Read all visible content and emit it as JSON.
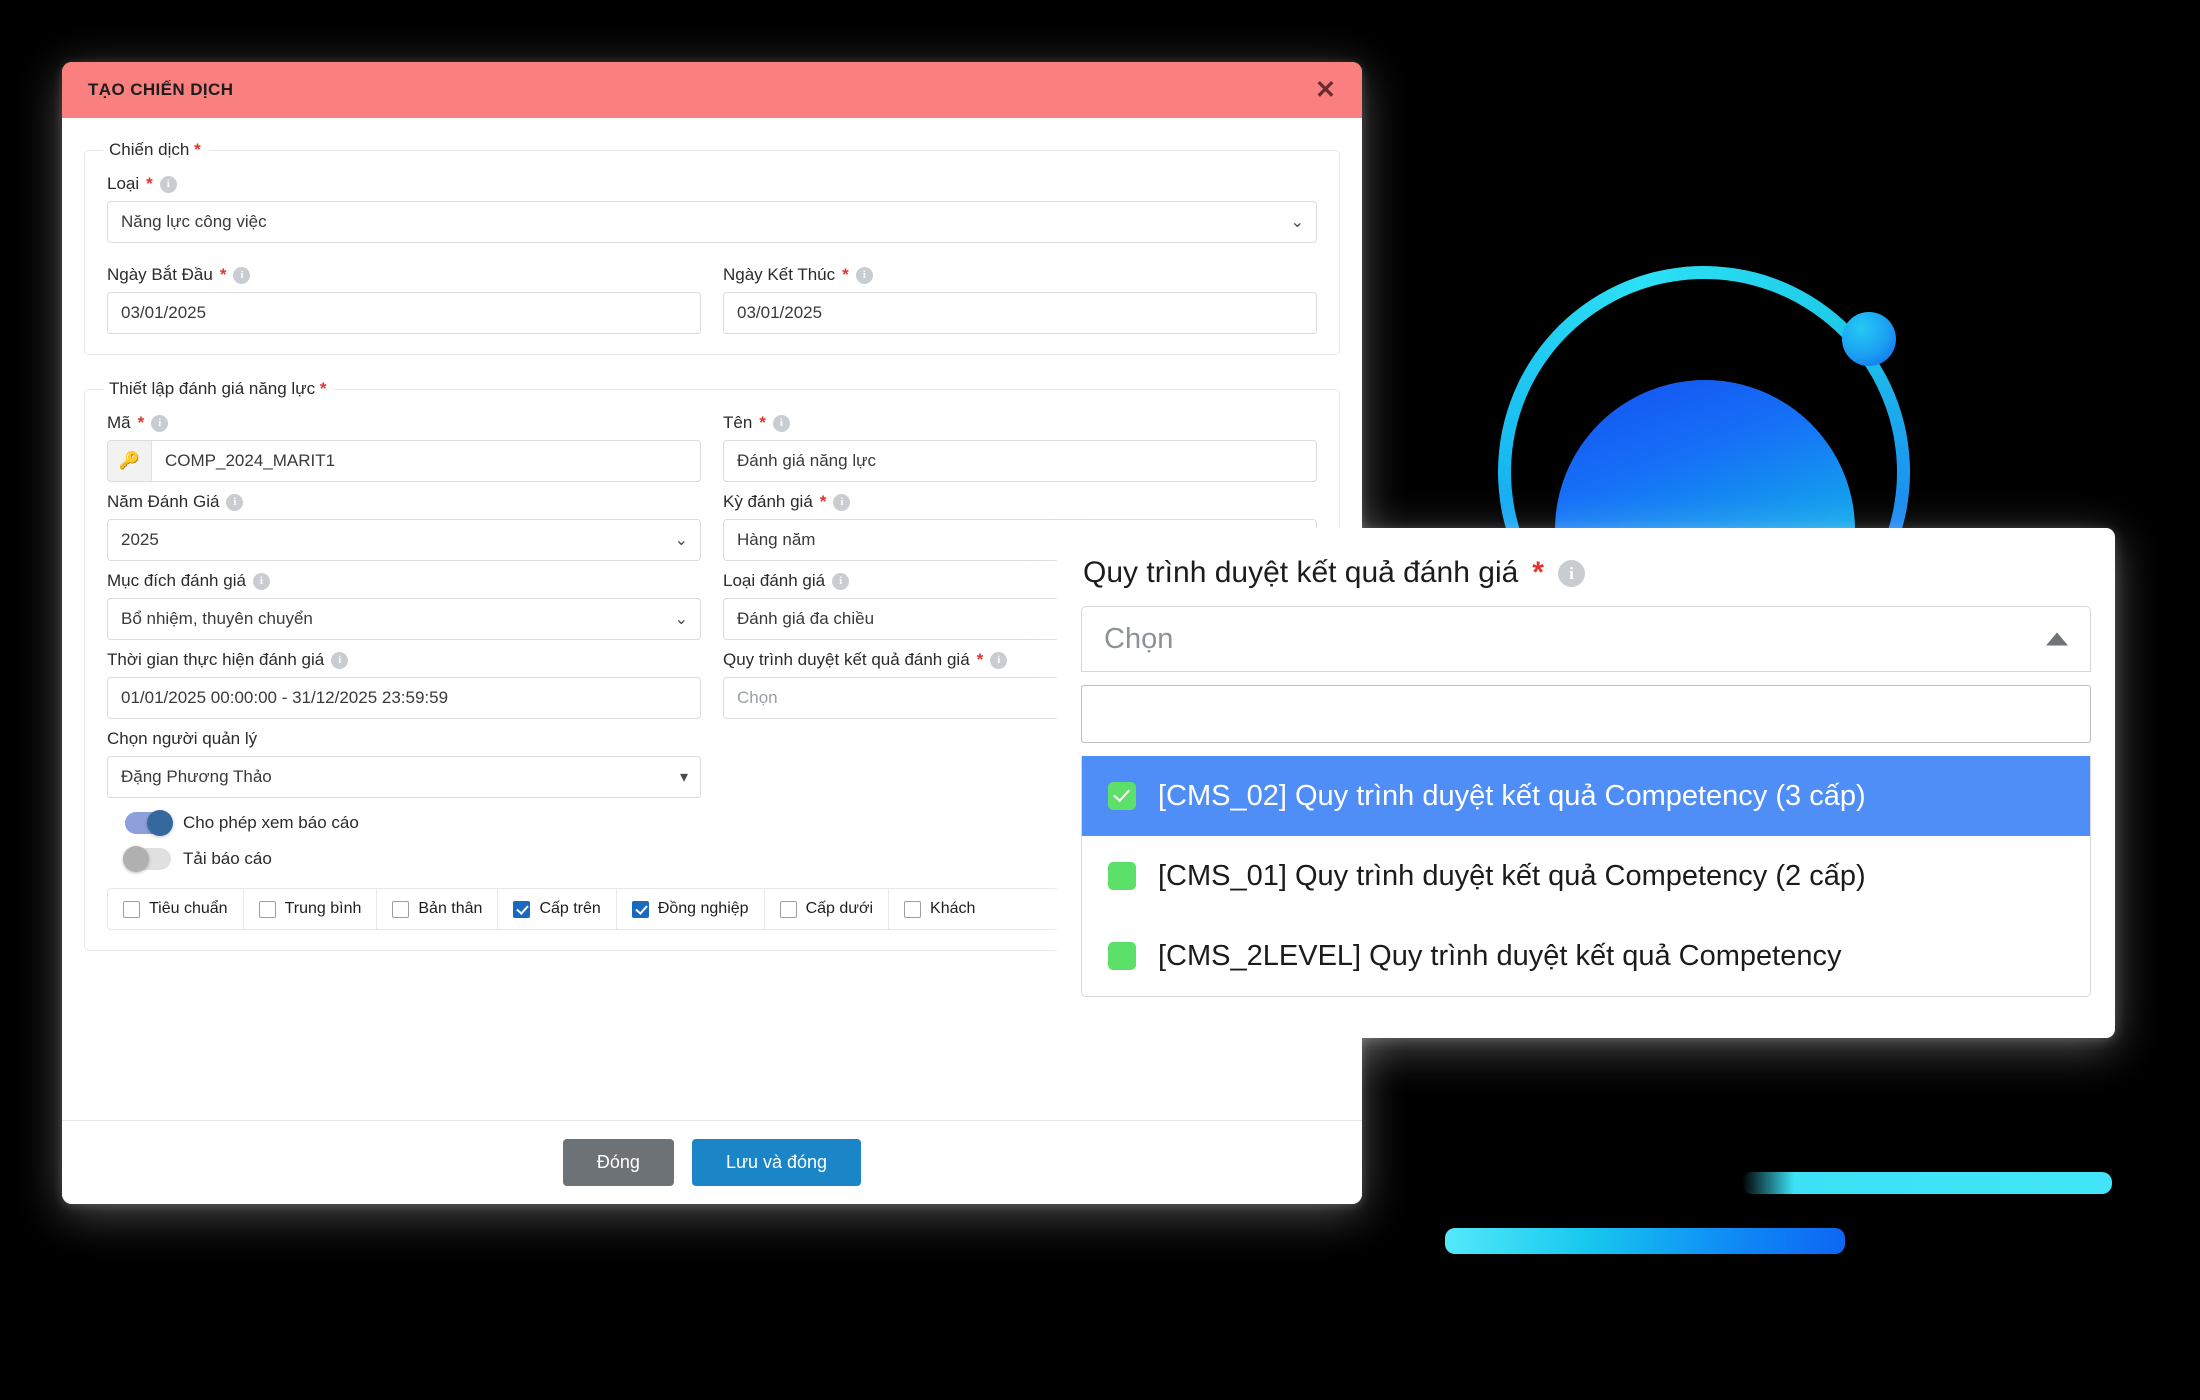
{
  "modal": {
    "title": "TẠO CHIẾN DỊCH",
    "close_icon": "close-icon",
    "footer": {
      "close_label": "Đóng",
      "save_label": "Lưu và đóng"
    }
  },
  "groups": [
    {
      "legend": "Chiến dịch",
      "required": "*"
    },
    {
      "legend": "Thiết lập đánh giá năng lực",
      "required": "*"
    }
  ],
  "campaign": {
    "type_label": "Loại",
    "type_value": "Năng lực công việc",
    "start_label": "Ngày Bắt Đầu",
    "start_value": "03/01/2025",
    "end_label": "Ngày Kết Thúc",
    "end_value": "03/01/2025"
  },
  "setup": {
    "code_label": "Mã",
    "code_value": "COMP_2024_MARIT1",
    "code_icon": "key-icon",
    "name_label": "Tên",
    "name_value": "Đánh giá năng lực",
    "year_label": "Năm Đánh Giá",
    "year_value": "2025",
    "period_label": "Kỳ đánh giá",
    "period_value": "Hàng năm",
    "purpose_label": "Mục đích đánh giá",
    "purpose_value": "Bổ nhiệm, thuyên chuyển",
    "eval_type_label": "Loại đánh giá",
    "eval_type_value": "Đánh giá đa chiều",
    "timeframe_label": "Thời gian thực hiện đánh giá",
    "timeframe_value": "01/01/2025 00:00:00 - 31/12/2025 23:59:59",
    "approval_label": "Quy trình duyệt kết quả đánh giá",
    "approval_placeholder": "Chọn",
    "manager_label": "Chọn người quản lý",
    "manager_value": "Đặng Phương Thảo"
  },
  "toggles": [
    {
      "label": "Cho phép xem báo cáo",
      "state": "on"
    },
    {
      "label": "Tải báo cáo",
      "state": "off"
    }
  ],
  "checkboxes": [
    {
      "label": "Tiêu chuẩn",
      "checked": false
    },
    {
      "label": "Trung bình",
      "checked": false
    },
    {
      "label": "Bản thân",
      "checked": false
    },
    {
      "label": "Cấp trên",
      "checked": true
    },
    {
      "label": "Đồng nghiệp",
      "checked": true
    },
    {
      "label": "Cấp dưới",
      "checked": false
    },
    {
      "label": "Khách",
      "checked": false
    }
  ],
  "zoom_panel": {
    "label": "Quy trình duyệt kết quả đánh giá",
    "required": "*",
    "info_icon": "info-icon",
    "select_placeholder": "Chọn",
    "search_value": "",
    "caret_icon": "caret-up-icon",
    "options": [
      {
        "label": "[CMS_02] Quy trình duyệt kết quả Competency (3 cấp)",
        "selected": true
      },
      {
        "label": "[CMS_01] Quy trình duyệt kết quả Competency (2 cấp)",
        "selected": false
      },
      {
        "label": "[CMS_2LEVEL] Quy trình duyệt kết quả Competency",
        "selected": false
      }
    ]
  },
  "colors": {
    "header": "#FA8080",
    "primary_button": "#1A86C8",
    "secondary_button": "#6D7277",
    "required_star": "#E4332E",
    "selected_row": "#4F8EF7",
    "check_green": "#5DE06A",
    "checkbox_blue": "#1A6BBD"
  }
}
